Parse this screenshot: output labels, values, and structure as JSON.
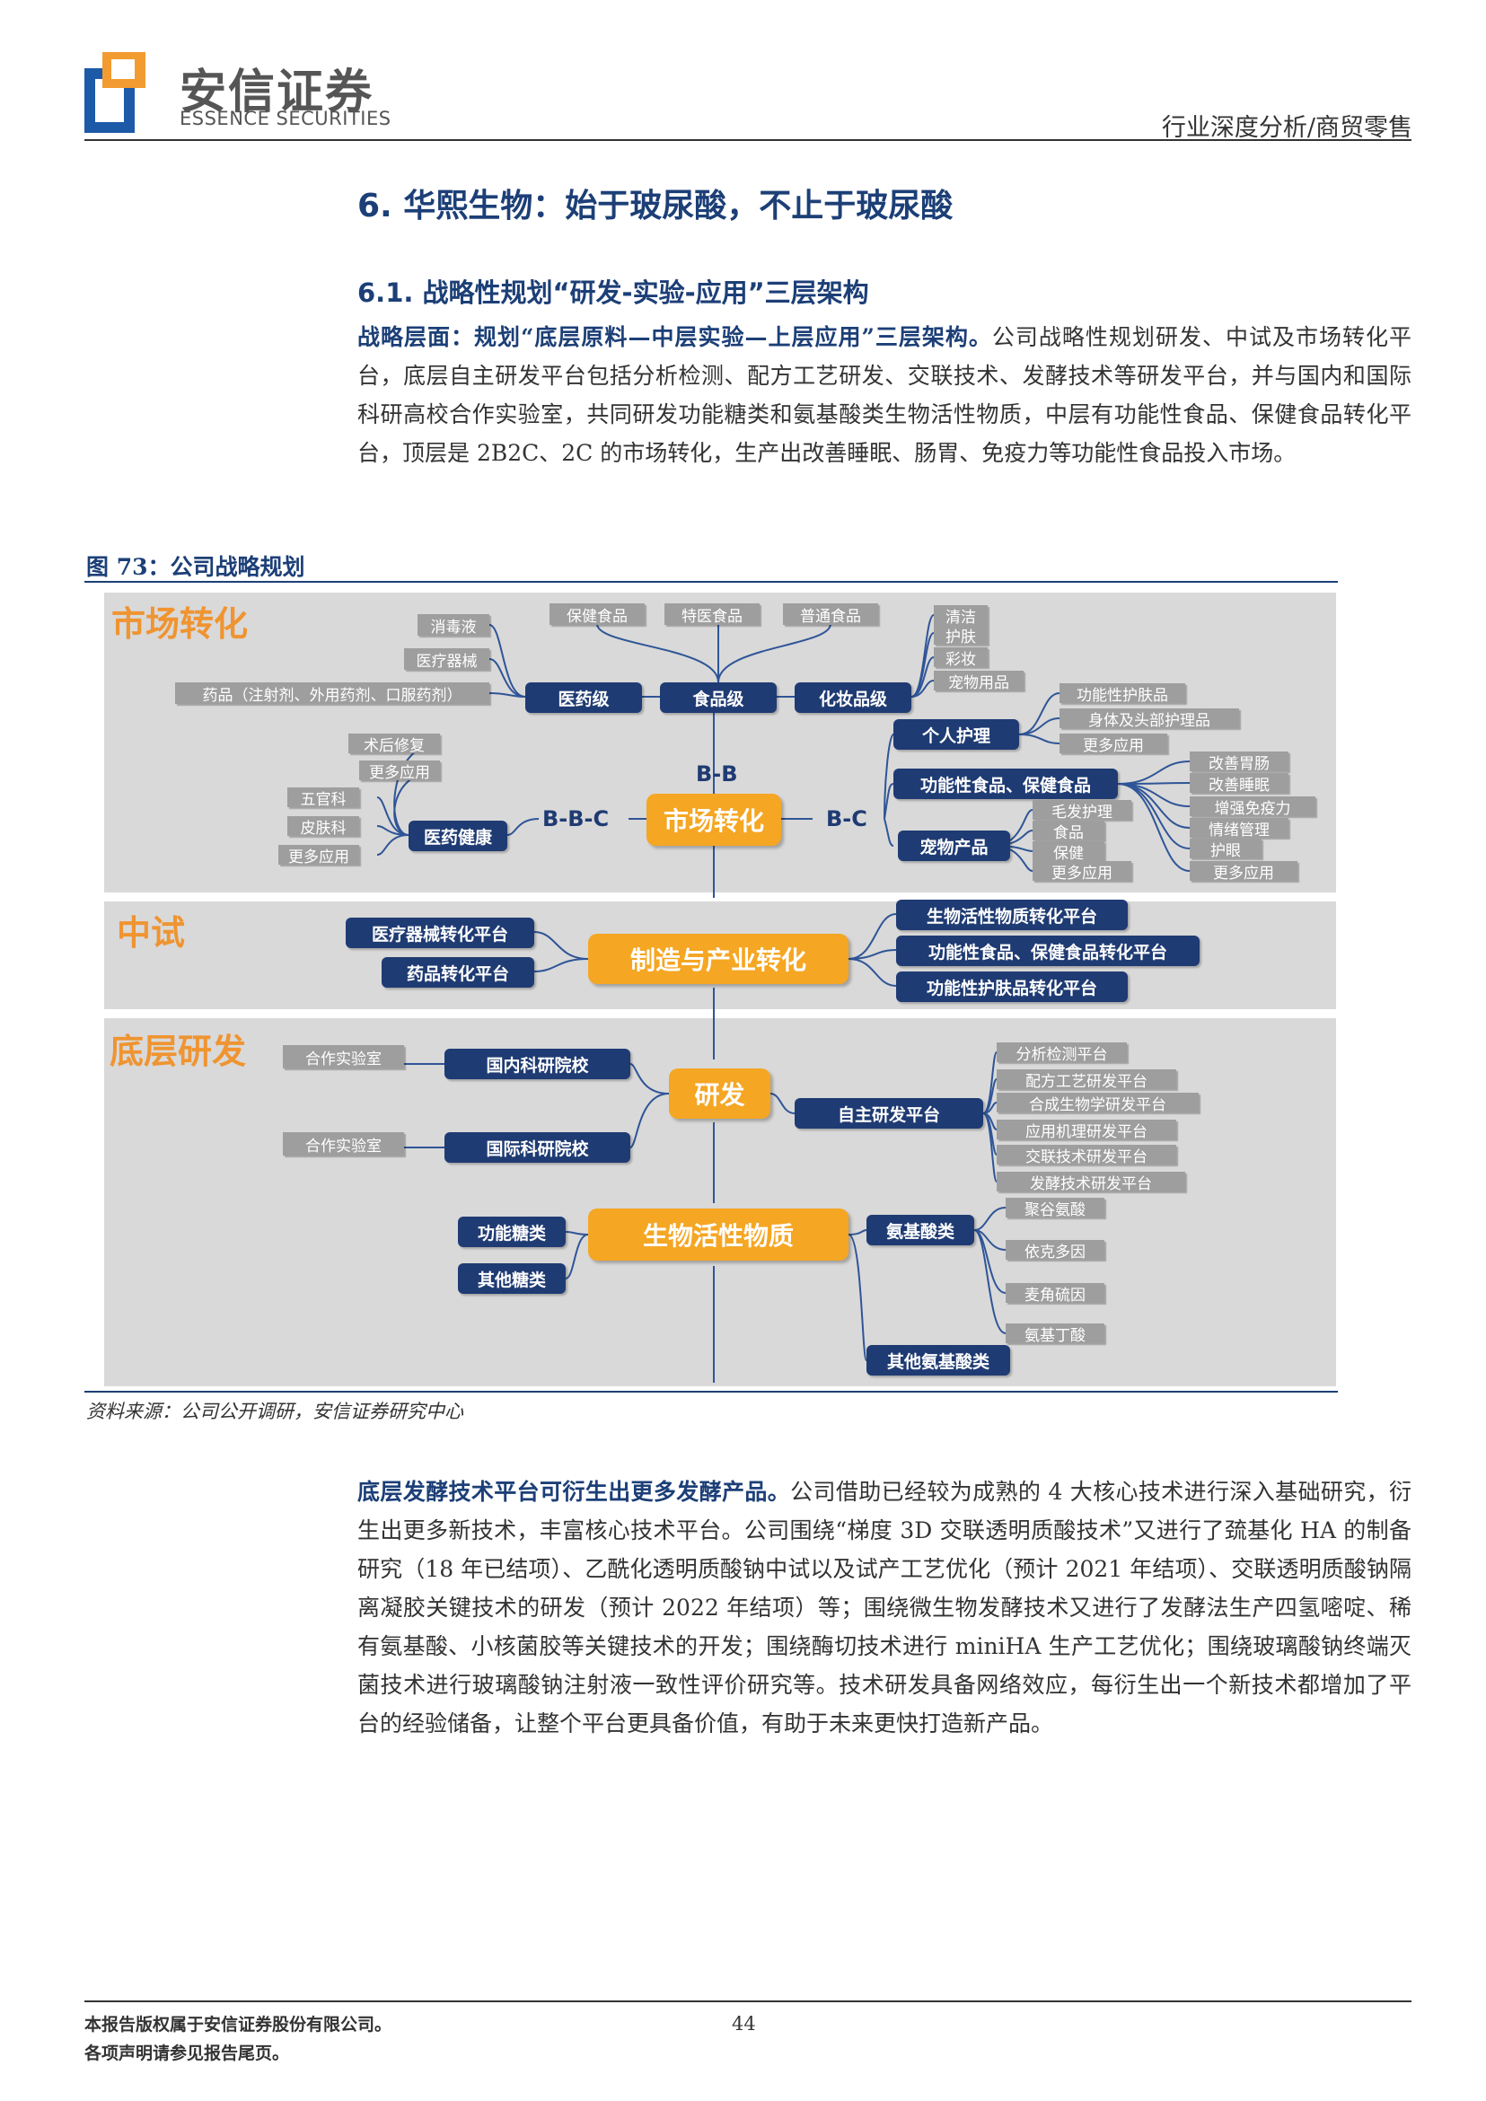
{
  "header": {
    "logo_cn": "安信证券",
    "logo_en": "ESSENCE SECURITIES",
    "category": "行业深度分析/商贸零售"
  },
  "section": {
    "h1": "6. 华熙生物：始于玻尿酸，不止于玻尿酸",
    "h2": "6.1. 战略性规划“研发-实验-应用”三层架构",
    "p1_bold": "战略层面：规划“底层原料—中层实验—上层应用”三层架构。",
    "p1_text": "公司战略性规划研发、中试及市场转化平台，底层自主研发平台包括分析检测、配方工艺研发、交联技术、发酵技术等研发平台，并与国内和国际科研高校合作实验室，共同研发功能糖类和氨基酸类生物活性物质，中层有功能性食品、保健食品转化平台，顶层是 2B2C、2C 的市场转化，生产出改善睡眠、肠胃、免疫力等功能性食品投入市场。"
  },
  "figure": {
    "title": "图 73：公司战略规划",
    "source": "资料来源：公司公开调研，安信证券研究中心",
    "zones": [
      "市场转化",
      "中试",
      "底层研发"
    ],
    "market": {
      "center": "市场转化",
      "bb": "B-B",
      "bbc": "B-B-C",
      "bc": "B-C",
      "level_boxes": [
        "医药级",
        "食品级",
        "化妆品级"
      ],
      "pharma_items": [
        "消毒液",
        "医疗器械",
        "药品（注射剂、外用药剂、口服药剂）"
      ],
      "food_items": [
        "保健食品",
        "特医食品",
        "普通食品"
      ],
      "cosmetic_items": [
        "清洁",
        "护肤",
        "彩妆",
        "宠物用品"
      ],
      "health": "医药健康",
      "health_items": [
        "术后修复",
        "更多应用",
        "五官科",
        "皮肤科",
        "更多应用"
      ],
      "personal_care": "个人护理",
      "personal_care_items": [
        "功能性护肤品",
        "身体及头部护理品",
        "更多应用"
      ],
      "functional_food": "功能性食品、保健食品",
      "functional_food_items": [
        "改善胃肠",
        "改善睡眠",
        "增强免疫力",
        "情绪管理",
        "护眼",
        "更多应用"
      ],
      "pet": "宠物产品",
      "pet_items": [
        "毛发护理",
        "食品",
        "保健",
        "更多应用"
      ]
    },
    "pilot": {
      "center": "制造与产业转化",
      "left": [
        "医疗器械转化平台",
        "药品转化平台"
      ],
      "right": [
        "生物活性物质转化平台",
        "功能性食品、保健食品转化平台",
        "功能性护肤品转化平台"
      ]
    },
    "rnd": {
      "center": "研发",
      "domestic": "国内科研院校",
      "intl": "国际科研院校",
      "lab": "合作实验室",
      "own": "自主研发平台",
      "own_items": [
        "分析检测平台",
        "配方工艺研发平台",
        "合成生物学研发平台",
        "应用机理研发平台",
        "交联技术研发平台",
        "发酵技术研发平台"
      ],
      "bio": "生物活性物质",
      "sugar_func": "功能糖类",
      "sugar_other": "其他糖类",
      "amino": "氨基酸类",
      "amino_items": [
        "聚谷氨酸",
        "依克多因",
        "麦角硫因",
        "氨基丁酸"
      ],
      "amino_other": "其他氨基酸类"
    }
  },
  "para2": {
    "bold": "底层发酵技术平台可衍生出更多发酵产品。",
    "text": "公司借助已经较为成熟的 4 大核心技术进行深入基础研究，衍生出更多新技术，丰富核心技术平台。公司围绕“梯度 3D 交联透明质酸技术”又进行了巯基化 HA 的制备研究（18 年已结项）、乙酰化透明质酸钠中试以及试产工艺优化（预计 2021 年结项）、交联透明质酸钠隔离凝胶关键技术的研发（预计 2022 年结项）等；围绕微生物发酵技术又进行了发酵法生产四氢嘧啶、稀有氨基酸、小核菌胶等关键技术的开发；围绕酶切技术进行 miniHA 生产工艺优化；围绕玻璃酸钠终端灭菌技术进行玻璃酸钠注射液一致性评价研究等。技术研发具备网络效应，每衍生出一个新技术都增加了平台的经验储备，让整个平台更具备价值，有助于未来更快打造新产品。"
  },
  "footer": {
    "line1": "本报告版权属于安信证券股份有限公司。",
    "line2": "各项声明请参见报告尾页。",
    "page": "44"
  }
}
